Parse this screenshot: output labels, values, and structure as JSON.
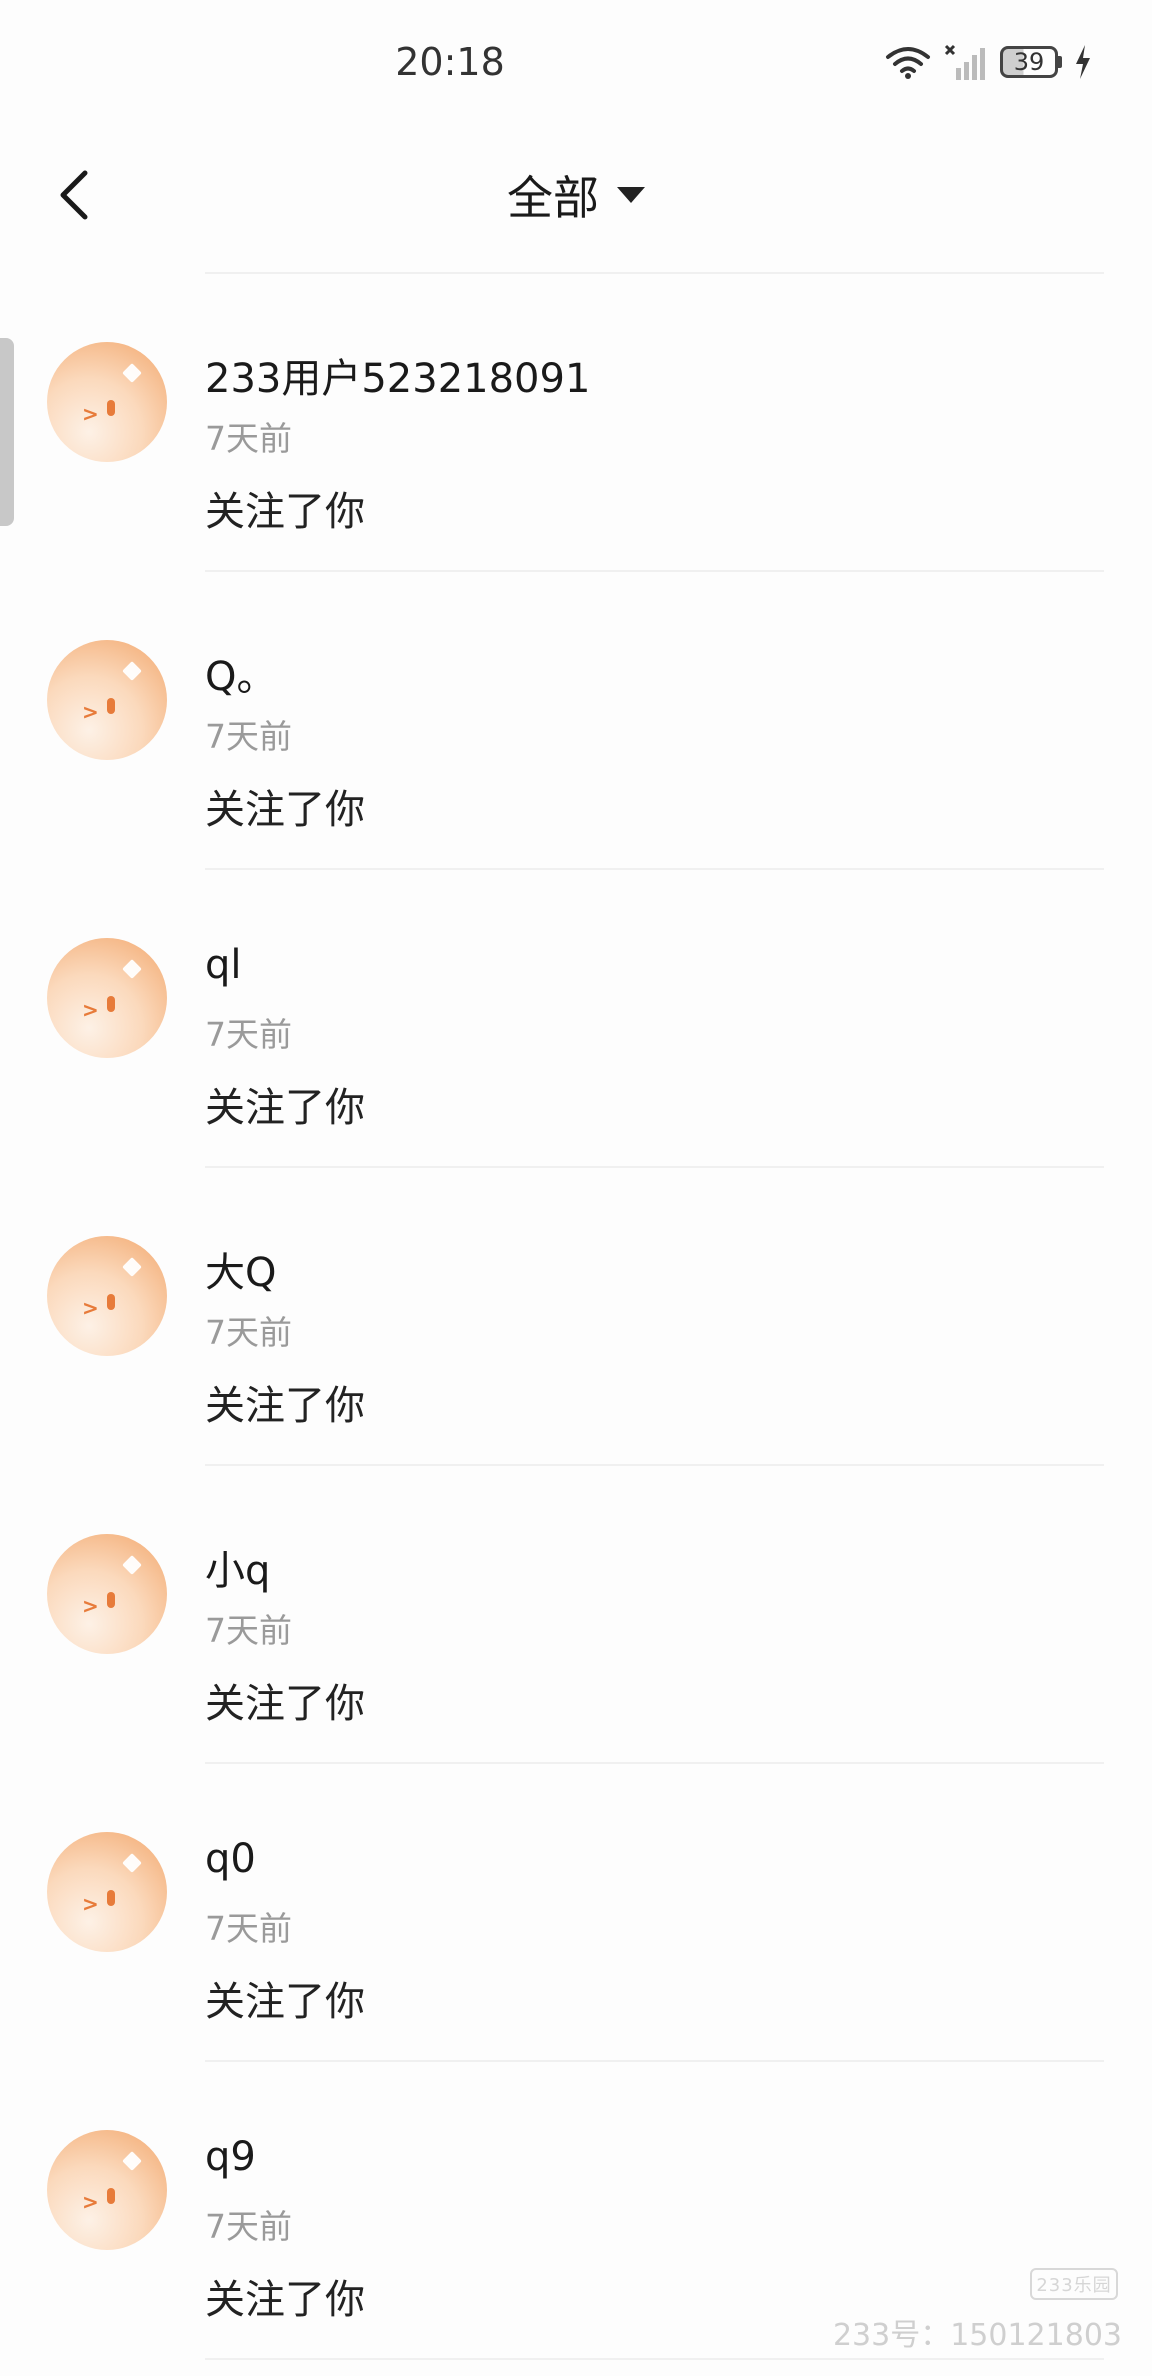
{
  "status_bar": {
    "time": "20:18",
    "battery": "39",
    "icons": [
      "wifi-icon",
      "signal-icon",
      "battery-icon",
      "charging-bolt-icon"
    ]
  },
  "header": {
    "back_icon": "chevron-left-icon",
    "filter_label": "全部",
    "filter_icon": "caret-down-icon"
  },
  "notifications": [
    {
      "name": "233用户523218091",
      "time": "7天前",
      "action": "关注了你"
    },
    {
      "name": "Q。",
      "time": "7天前",
      "action": "关注了你"
    },
    {
      "name": "ql",
      "time": "7天前",
      "action": "关注了你"
    },
    {
      "name": "大Q",
      "time": "7天前",
      "action": "关注了你"
    },
    {
      "name": "小q",
      "time": "7天前",
      "action": "关注了你"
    },
    {
      "name": "q0",
      "time": "7天前",
      "action": "关注了你"
    },
    {
      "name": "q9",
      "time": "7天前",
      "action": "关注了你"
    }
  ],
  "watermark": {
    "logo": "233乐园",
    "id_text": "233号：150121803"
  },
  "colors": {
    "background": "#fdfdfd",
    "avatar_orange": "#f2a66b",
    "secondary_text": "#9a9a9a"
  }
}
